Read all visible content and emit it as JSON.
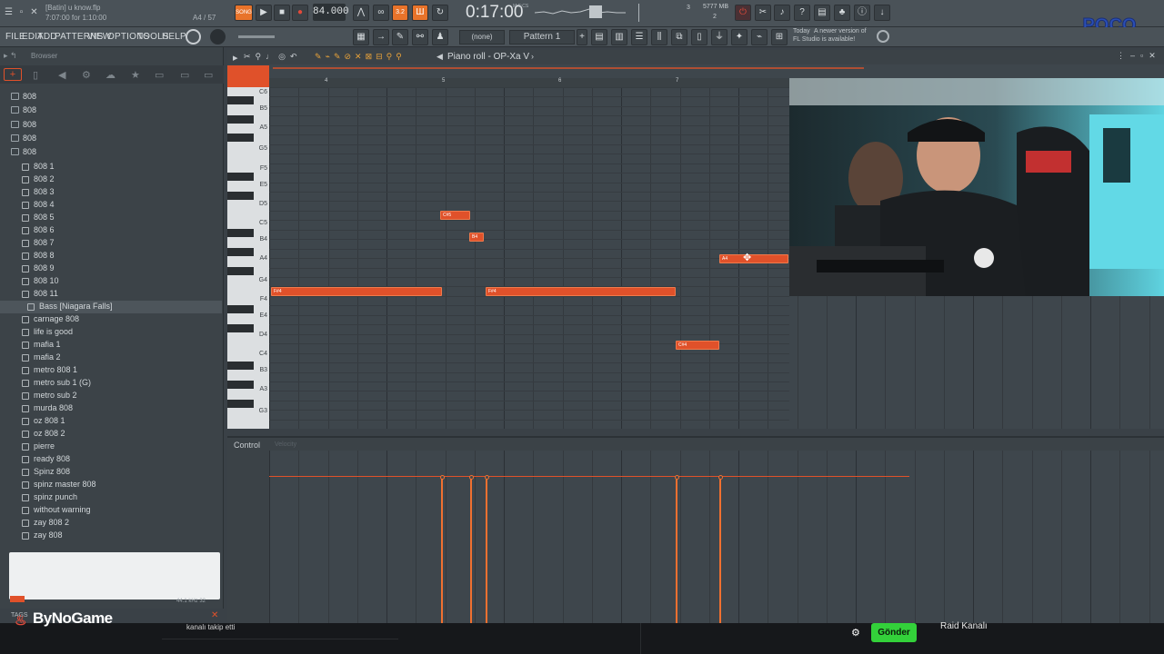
{
  "window": {
    "title": "[Batin] u know.flp",
    "time_info": "7:07:00 for 1:10:00",
    "position": "A4 / 57",
    "song_label": "SONG"
  },
  "transport": {
    "bpm": "84.000",
    "time": "0:17:00",
    "time_small": "M:S:CS",
    "memory": "5777 MB",
    "counter_a": "3",
    "counter_b": "2",
    "channel_sel": "(none)",
    "pattern": "Pattern 1"
  },
  "menu": [
    "FILE",
    "EDIT",
    "ADD",
    "PATTERNS",
    "VIEW",
    "OPTIONS",
    "TOOLS",
    "HELP"
  ],
  "news": {
    "day": "Today",
    "line1": "A newer version of",
    "line2": "FL Studio is available!"
  },
  "browser": {
    "title": "Browser",
    "folders": [
      "808",
      "808",
      "808",
      "808",
      "808"
    ],
    "items": [
      "808 1",
      "808 2",
      "808 3",
      "808 4",
      "808 5",
      "808 6",
      "808 7",
      "808 8",
      "808 9",
      "808 10",
      "808 11"
    ],
    "selected": "Bass [Niagara Falls]",
    "items2": [
      "carnage 808",
      "life is good",
      "mafia 1",
      "mafia 2",
      "metro 808 1",
      "metro sub 1 (G)",
      "metro sub 2",
      "murda 808",
      "oz 808 1",
      "oz 808 2",
      "pierre",
      "ready 808",
      "Spinz 808",
      "spinz master 808",
      "spinz punch",
      "without warning",
      "zay 808 2",
      "zay 808"
    ],
    "preview_info": "44.1 kHz 32",
    "tags_label": "TAGS"
  },
  "piano_roll": {
    "title": "Piano roll - OP-Xa V",
    "ruler": [
      "4",
      "5",
      "6",
      "7"
    ],
    "keys": [
      "C6",
      "B5",
      "A5",
      "G5",
      "F5",
      "E5",
      "D5",
      "C5",
      "B4",
      "A4",
      "G4",
      "F4",
      "E4",
      "D4",
      "C4",
      "B3",
      "A3",
      "G3"
    ],
    "notes": [
      {
        "label": "F#4"
      },
      {
        "label": "C#5"
      },
      {
        "label": "B4"
      },
      {
        "label": "F#4"
      },
      {
        "label": "C#4"
      },
      {
        "label": "A4"
      }
    ],
    "control_label": "Control",
    "control_sub": "Velocity"
  },
  "overlay": {
    "brand": "ByNoGame",
    "chat_msg": "kanalı takip etti",
    "send_label": "Gönder",
    "raid_label": "Raid Kanalı",
    "logo_text": "POCO"
  },
  "colors": {
    "accent": "#e0512a",
    "send": "#33d13a"
  }
}
